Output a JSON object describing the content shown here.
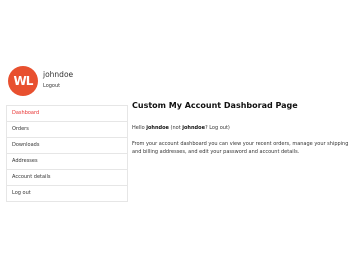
{
  "profile": {
    "avatar_text": "WL",
    "avatar_color": "#e8502f",
    "username": "johndoe",
    "logout_label": "Logout"
  },
  "nav": {
    "items": [
      {
        "label": "Dashboard",
        "active": true
      },
      {
        "label": "Orders"
      },
      {
        "label": "Downloads"
      },
      {
        "label": "Addresses"
      },
      {
        "label": "Account details"
      },
      {
        "label": "Log out"
      }
    ]
  },
  "main": {
    "title": "Custom My Account Dashborad Page",
    "greeting": {
      "prefix": "Hello ",
      "name": "johndoe",
      "middle": " (not ",
      "name2": "johndoe",
      "link": "? Log out",
      "suffix": ")"
    },
    "description": "From your account dashboard you can view your recent orders, manage your shipping and billing addresses, and edit your password and account details."
  },
  "colors": {
    "accent": "#e8302f",
    "border": "#e6e6e6"
  }
}
